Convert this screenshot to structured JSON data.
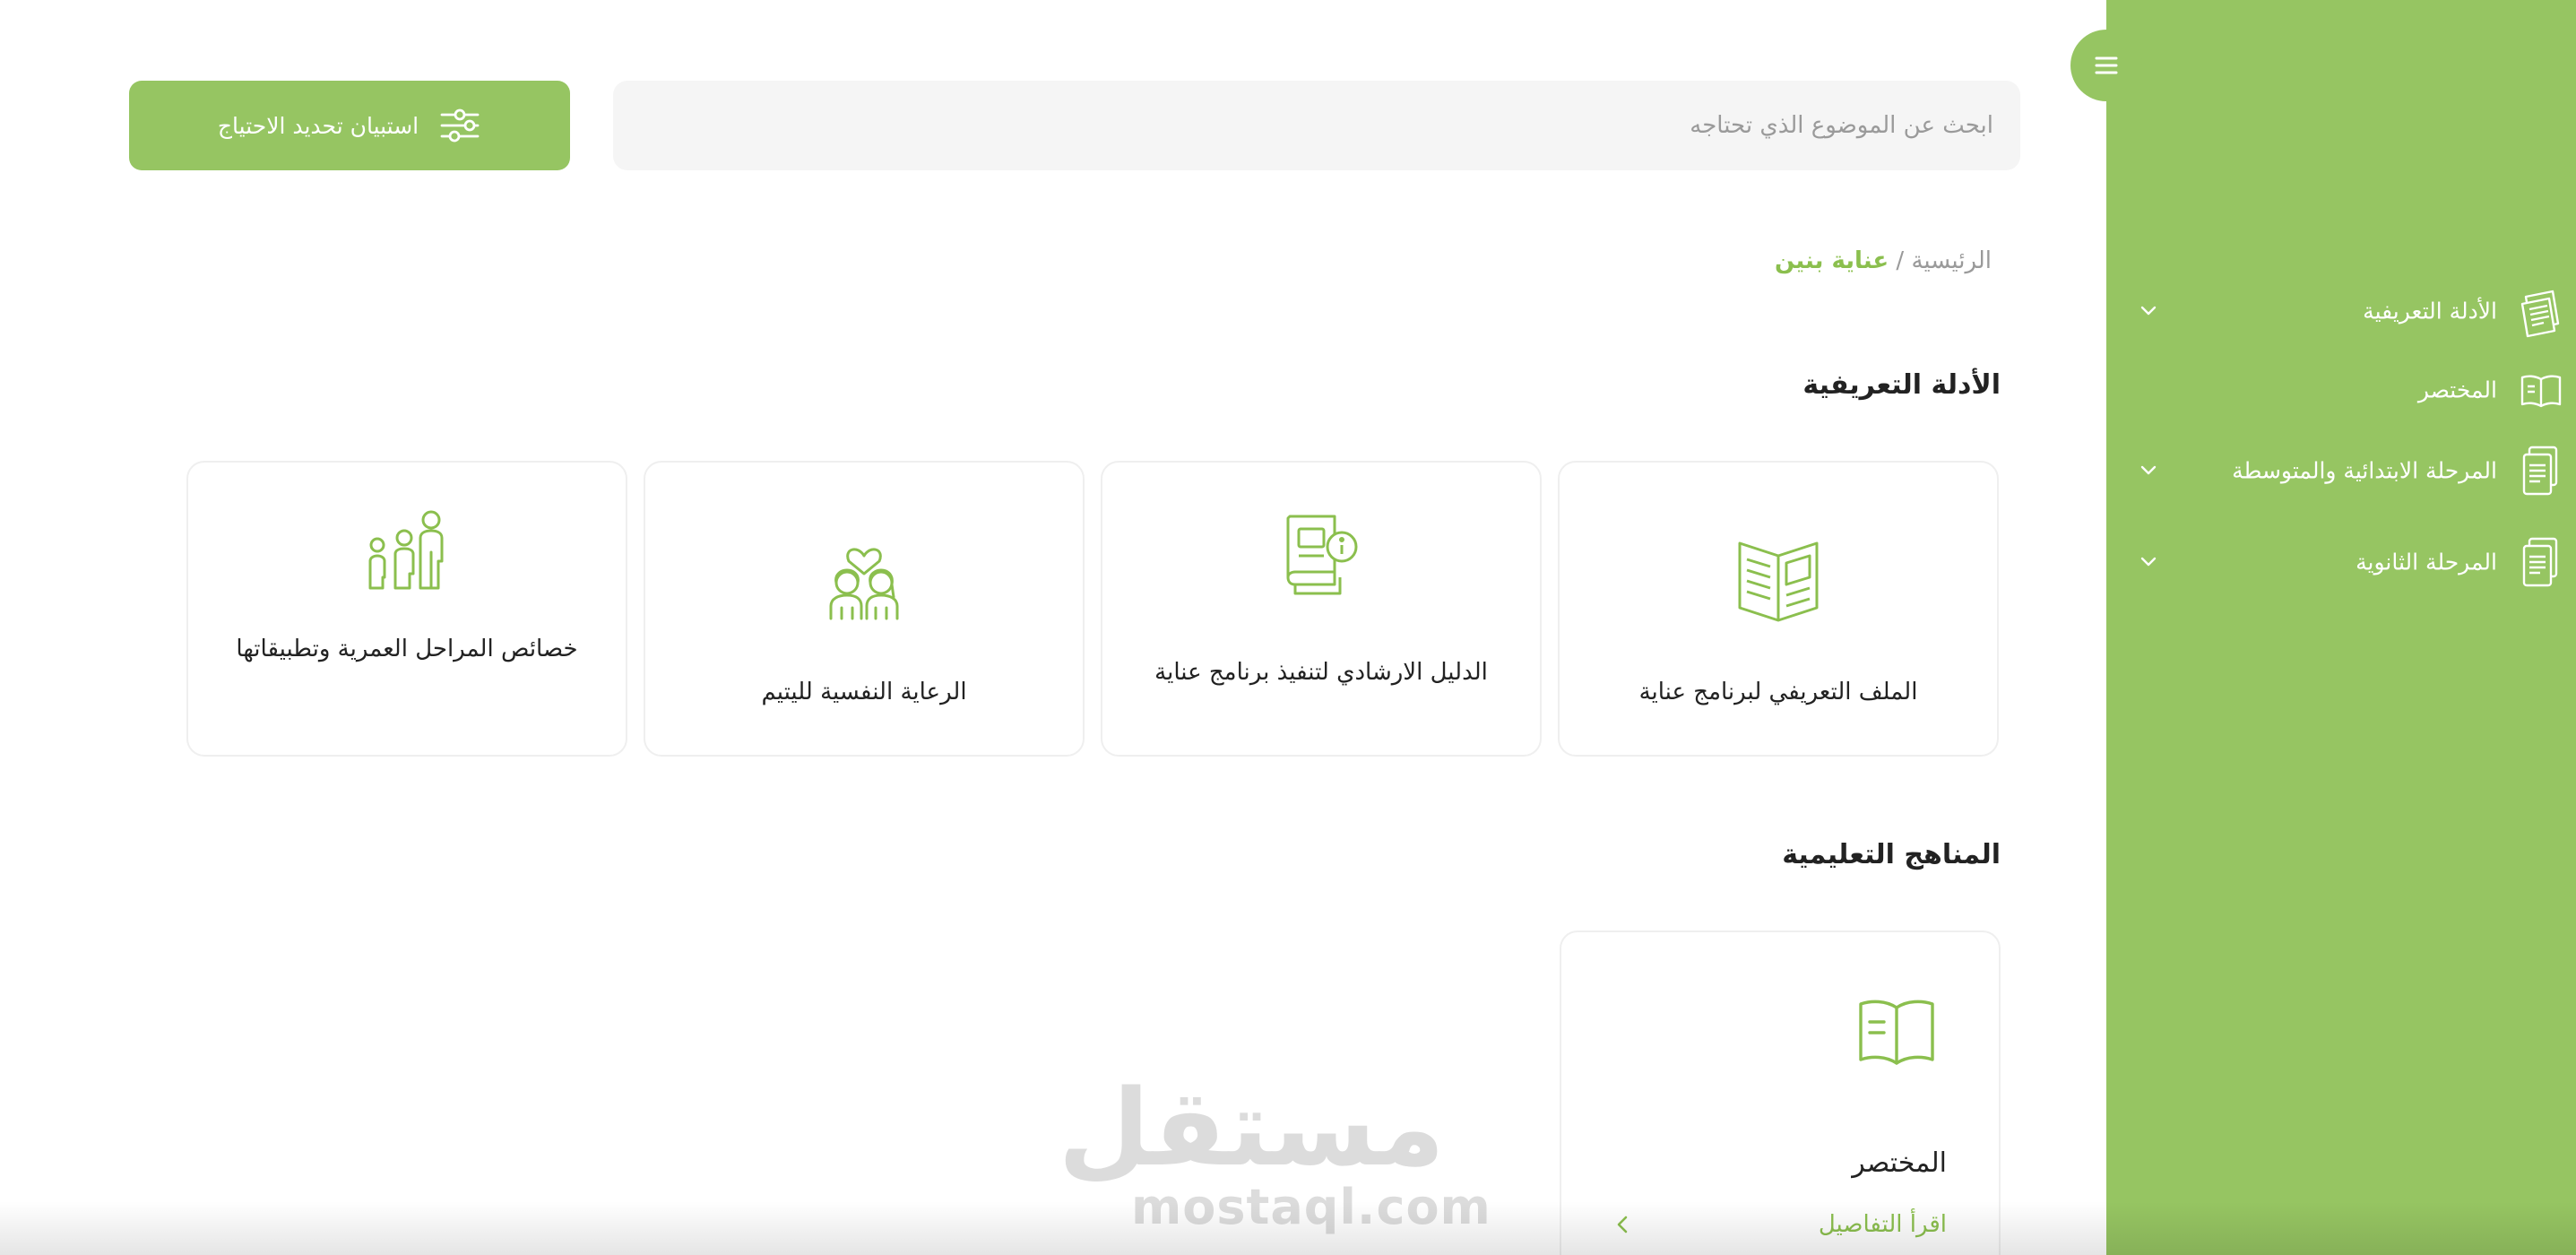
{
  "colors": {
    "accent": "#96c562",
    "accent_text": "#8bbf4e",
    "sidebar_bg": "#96c562"
  },
  "sidebar": {
    "toggle_icon": "hamburger-icon",
    "items": [
      {
        "label": "الأدلة التعريفية",
        "icon": "documents-icon",
        "expandable": true
      },
      {
        "label": "المختصر",
        "icon": "open-book-icon",
        "expandable": false
      },
      {
        "label": "المرحلة الابتدائية والمتوسطة",
        "icon": "document-stack-icon",
        "expandable": true
      },
      {
        "label": "المرحلة الثانوية",
        "icon": "document-stack-icon",
        "expandable": true
      }
    ]
  },
  "search": {
    "placeholder": "ابحث عن الموضوع الذي تحتاجه",
    "value": ""
  },
  "survey_button": {
    "label": "استبيان تحديد الاحتياج",
    "icon": "sliders-icon"
  },
  "breadcrumb": {
    "home": "الرئيسية",
    "separator": "/",
    "current": "عناية بنين"
  },
  "sections": {
    "guides": {
      "title": "الأدلة التعريفية",
      "cards": [
        {
          "title": "الملف التعريفي لبرنامج عناية",
          "icon": "open-magazine-icon"
        },
        {
          "title": "الدليل الارشادي لتنفيذ برنامج عناية",
          "icon": "guide-book-info-icon"
        },
        {
          "title": "الرعاية النفسية لليتيم",
          "icon": "children-heart-icon"
        },
        {
          "title": "خصائص المراحل العمرية وتطبيقاتها",
          "icon": "age-stages-icon"
        }
      ]
    },
    "curricula": {
      "title": "المناهج التعليمية",
      "cards": [
        {
          "title": "المختصر",
          "icon": "open-book-icon",
          "link": "اقرأ التفاصيل"
        }
      ]
    }
  },
  "watermark": {
    "arabic": "مستقل",
    "latin": "mostaql.com"
  }
}
